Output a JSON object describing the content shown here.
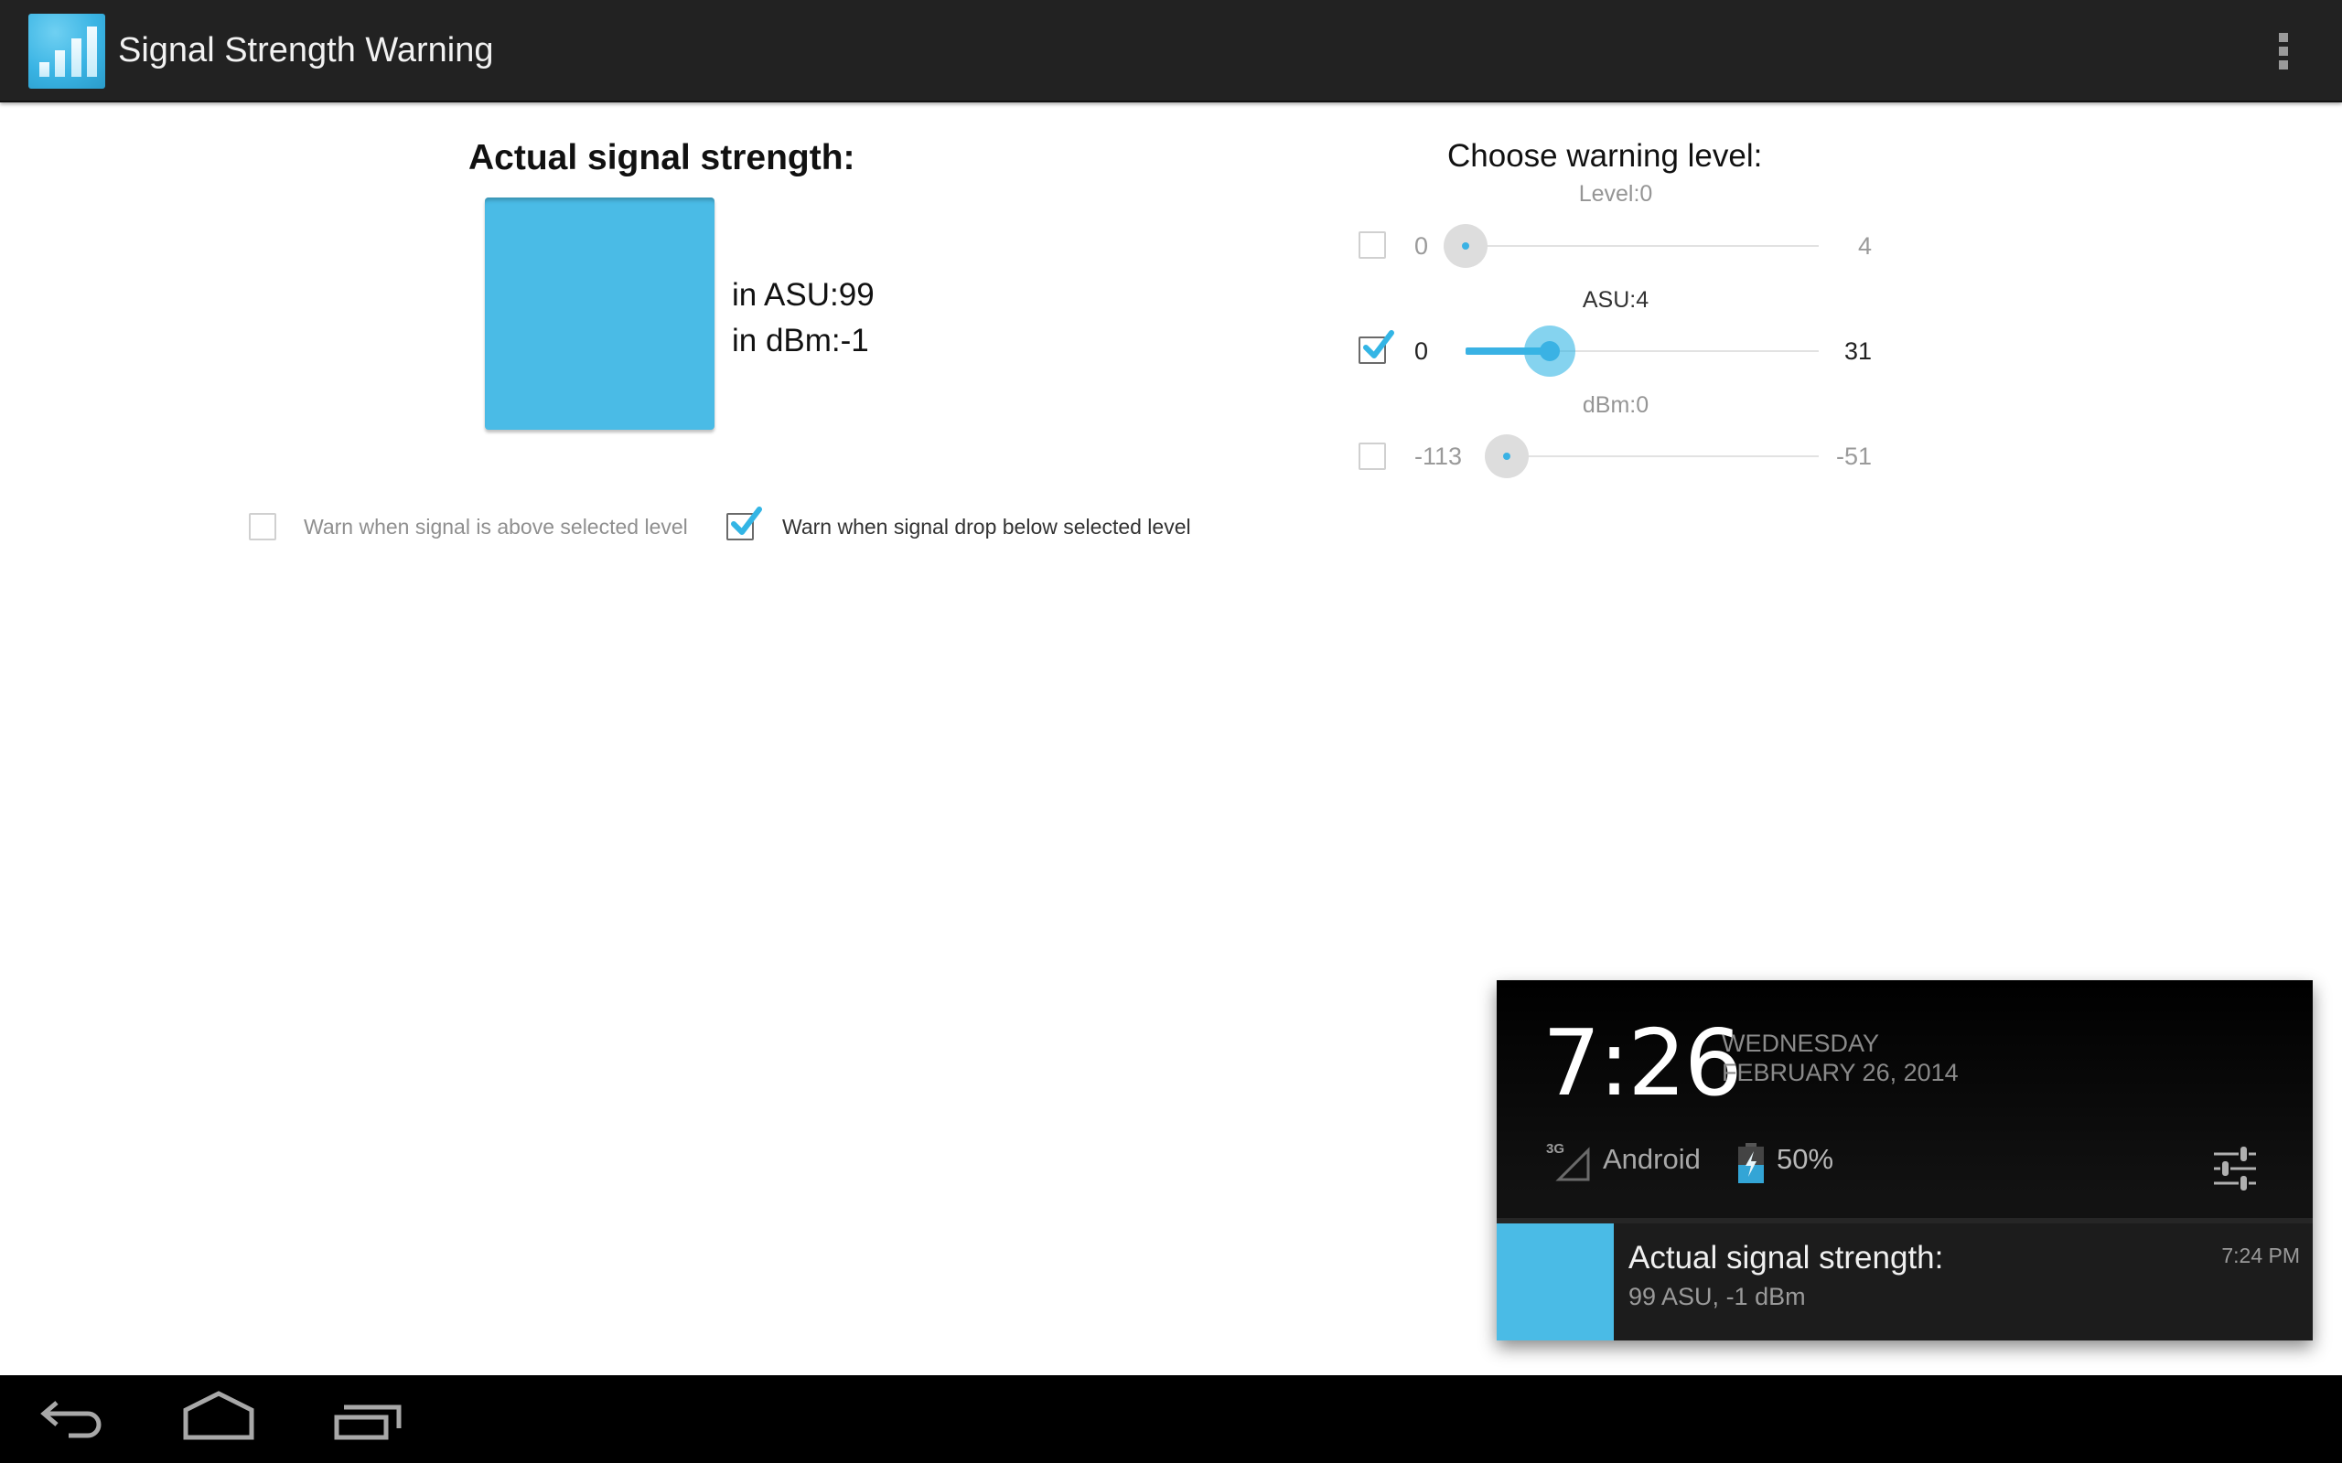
{
  "app": {
    "title": "Signal Strength Warning",
    "icon": "signal-bars-icon",
    "overflow_icon": "overflow-menu-icon"
  },
  "actual": {
    "title": "Actual signal strength:",
    "indicator_color": "#4abbe6",
    "asu_text": "in ASU:99",
    "dbm_text": "in dBm:-1"
  },
  "warn_options": {
    "above": {
      "label": "Warn when signal is above selected level",
      "checked": false
    },
    "below": {
      "label": "Warn when signal drop below selected level",
      "checked": true
    }
  },
  "warning_level": {
    "title": "Choose warning level:",
    "sliders": [
      {
        "label": "Level:0",
        "enabled": false,
        "min": "0",
        "max": "4",
        "min_value": 0,
        "max_value": 4,
        "value": 0
      },
      {
        "label": "ASU:4",
        "enabled": true,
        "min": "0",
        "max": "31",
        "min_value": 0,
        "max_value": 31,
        "value": 4
      },
      {
        "label": "dBm:0",
        "enabled": false,
        "min": "-113",
        "max": "-51",
        "min_value": -113,
        "max_value": -51,
        "value": -113
      }
    ]
  },
  "notification_shade": {
    "clock": "7:26",
    "weekday": "WEDNESDAY",
    "date": "FEBRUARY 26, 2014",
    "network_type": "3G",
    "carrier": "Android",
    "battery_percent": "50%",
    "battery_level": 0.5,
    "accent_color": "#33b5e5",
    "settings_icon": "quick-settings-icon",
    "notification": {
      "title": "Actual signal strength:",
      "text": "99 ASU, -1 dBm",
      "time": "7:24 PM"
    }
  },
  "navbar": {
    "buttons": [
      "back",
      "home",
      "recent-apps"
    ]
  }
}
